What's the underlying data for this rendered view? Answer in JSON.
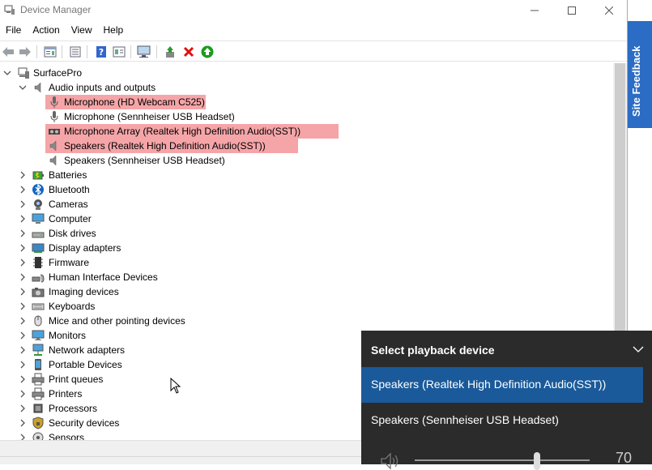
{
  "window": {
    "title": "Device Manager"
  },
  "menu": [
    "File",
    "Action",
    "View",
    "Help"
  ],
  "toolbar": {
    "buttons": [
      "back-icon",
      "forward-icon",
      "properties-icon",
      "show-hidden-icon",
      "help-icon",
      "details-icon",
      "monitor-scan-icon",
      "update-driver-icon",
      "uninstall-icon",
      "enable-icon"
    ]
  },
  "colors": {
    "highlight": "#f5a5a8",
    "flyout_bg": "#2b2b2b",
    "flyout_selected": "#1a5a9a",
    "feedback_tab": "#2b6cc4"
  },
  "tree": {
    "root": "SurfacePro",
    "audio_group": "Audio inputs and outputs",
    "audio_devices": [
      {
        "label": "Microphone (HD Webcam C525)",
        "icon": "microphone-icon",
        "highlighted": true
      },
      {
        "label": "Microphone (Sennheiser USB Headset)",
        "icon": "microphone-icon",
        "highlighted": false
      },
      {
        "label": "Microphone Array (Realtek High Definition Audio(SST))",
        "icon": "microphone-array-icon",
        "highlighted": true
      },
      {
        "label": "Speakers (Realtek High Definition Audio(SST))",
        "icon": "speaker-icon",
        "highlighted": true
      },
      {
        "label": "Speakers (Sennheiser USB Headset)",
        "icon": "speaker-icon",
        "highlighted": false
      }
    ],
    "categories": [
      {
        "label": "Batteries",
        "icon": "battery-icon"
      },
      {
        "label": "Bluetooth",
        "icon": "bluetooth-icon"
      },
      {
        "label": "Cameras",
        "icon": "camera-icon"
      },
      {
        "label": "Computer",
        "icon": "computer-icon"
      },
      {
        "label": "Disk drives",
        "icon": "disk-drive-icon"
      },
      {
        "label": "Display adapters",
        "icon": "display-adapter-icon"
      },
      {
        "label": "Firmware",
        "icon": "firmware-icon"
      },
      {
        "label": "Human Interface Devices",
        "icon": "hid-icon"
      },
      {
        "label": "Imaging devices",
        "icon": "imaging-icon"
      },
      {
        "label": "Keyboards",
        "icon": "keyboard-icon"
      },
      {
        "label": "Mice and other pointing devices",
        "icon": "mouse-icon"
      },
      {
        "label": "Monitors",
        "icon": "monitor-icon"
      },
      {
        "label": "Network adapters",
        "icon": "network-icon"
      },
      {
        "label": "Portable Devices",
        "icon": "portable-device-icon"
      },
      {
        "label": "Print queues",
        "icon": "printer-icon"
      },
      {
        "label": "Printers",
        "icon": "printer-icon"
      },
      {
        "label": "Processors",
        "icon": "processor-icon"
      },
      {
        "label": "Security devices",
        "icon": "security-icon"
      },
      {
        "label": "Sensors",
        "icon": "sensor-icon"
      }
    ]
  },
  "feedback": {
    "label": "Site Feedback"
  },
  "playback": {
    "header": "Select playback device",
    "options": [
      {
        "label": "Speakers (Realtek High Definition Audio(SST))",
        "selected": true
      },
      {
        "label": "Speakers (Sennheiser USB Headset)",
        "selected": false
      }
    ],
    "volume": 70
  }
}
